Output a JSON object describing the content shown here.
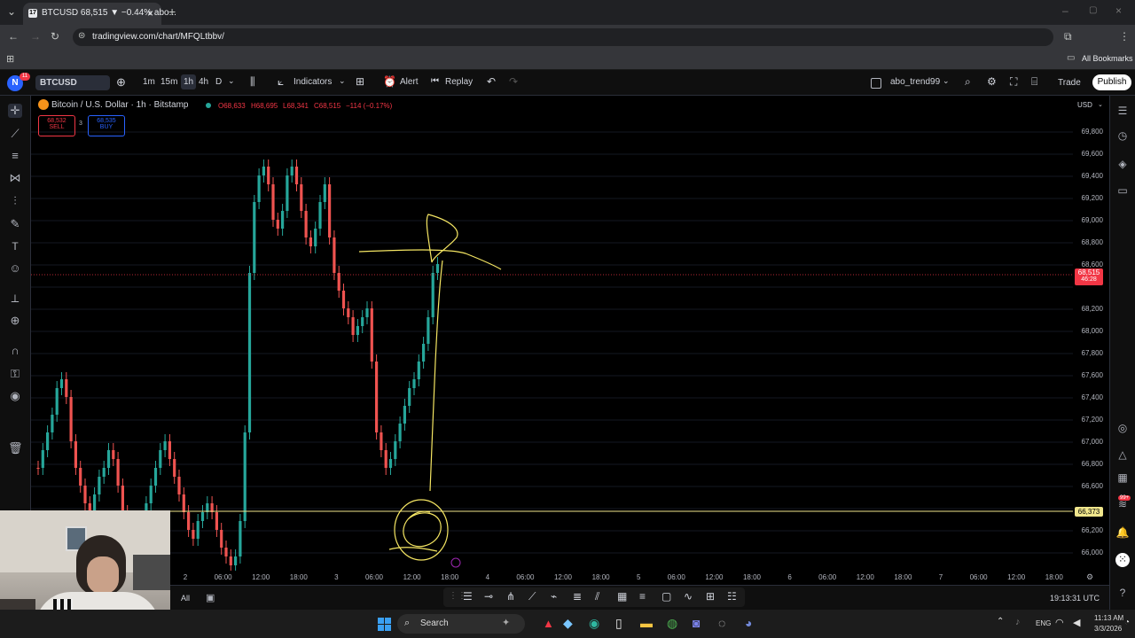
{
  "browser": {
    "tab_title": "BTCUSD 68,515 ▼ −0.44% abo...",
    "tab_icon": "17",
    "url": "tradingview.com/chart/MFQLtbbv/",
    "bookmarks_label": "All Bookmarks"
  },
  "toolbar": {
    "avatar_letter": "N",
    "avatar_badge": "11",
    "symbol": "BTCUSD",
    "intervals": [
      "1m",
      "15m",
      "1h",
      "4h",
      "D"
    ],
    "indicators_label": "Indicators",
    "alert_label": "Alert",
    "replay_label": "Replay",
    "layout_name": "abo_trend99",
    "trade_label": "Trade",
    "publish_label": "Publish"
  },
  "legend": {
    "symbol_desc": "Bitcoin / U.S. Dollar · 1h · Bitstamp",
    "open": "O68,633",
    "high": "H68,695",
    "low": "L68,341",
    "close": "C68,515",
    "change": "−114 (−0.17%)",
    "sell_price": "68,532",
    "sell_label": "SELL",
    "spread": "3",
    "buy_price": "68,535",
    "buy_label": "BUY"
  },
  "price_axis": {
    "currency": "USD",
    "labels": [
      "69,800",
      "69,600",
      "69,400",
      "69,200",
      "69,000",
      "68,800",
      "68,600",
      "68,200",
      "68,000",
      "67,800",
      "67,600",
      "67,400",
      "67,200",
      "67,000",
      "66,800",
      "66,600",
      "66,200",
      "66,000"
    ],
    "current_price": "68,515",
    "countdown": "46:28",
    "hline_price": "66,373"
  },
  "time_axis": {
    "labels": [
      "2",
      "06:00",
      "12:00",
      "18:00",
      "3",
      "06:00",
      "12:00",
      "18:00",
      "4",
      "06:00",
      "12:00",
      "18:00",
      "5",
      "06:00",
      "12:00",
      "18:00",
      "6",
      "06:00",
      "12:00",
      "18:00",
      "7",
      "06:00",
      "12:00",
      "18:00"
    ],
    "clock": "19:13:31 UTC"
  },
  "bottom": {
    "all_label": "All"
  },
  "taskbar": {
    "search_label": "Search",
    "lang": "ENG",
    "time": "11:13 AM",
    "date": "3/3/2026",
    "notif_badge": "99+"
  },
  "colors": {
    "up": "#26a69a",
    "down": "#ef5350",
    "hline": "#f0e68c",
    "drawing": "#f5e663",
    "price_tag": "#f23645"
  }
}
